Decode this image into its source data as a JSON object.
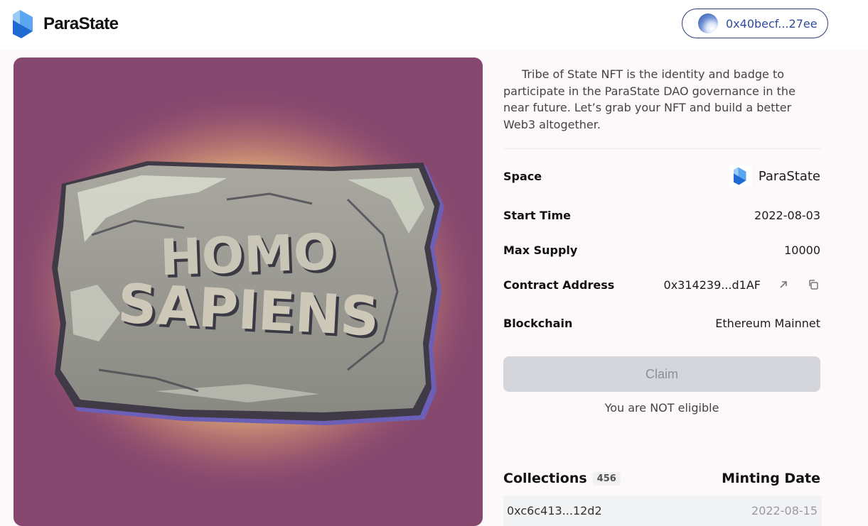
{
  "header": {
    "brand": "ParaState",
    "wallet_address": "0x40becf...27ee"
  },
  "nft": {
    "artwork_text_line1": "HOMO",
    "artwork_text_line2": "SAPIENS"
  },
  "description": "Tribe of State NFT is the identity and badge to participate in the ParaState DAO governance in the near future. Let’s grab your NFT and build a better Web3 altogether.",
  "details": {
    "space_label": "Space",
    "space_value": "ParaState",
    "start_time_label": "Start Time",
    "start_time_value": "2022-08-03",
    "max_supply_label": "Max Supply",
    "max_supply_value": "10000",
    "contract_label": "Contract Address",
    "contract_value": "0x314239...d1AF",
    "blockchain_label": "Blockchain",
    "blockchain_value": "Ethereum Mainnet"
  },
  "claim": {
    "button_label": "Claim",
    "eligibility_text": "You are NOT eligible"
  },
  "collections": {
    "title": "Collections",
    "count": "456",
    "minting_date_title": "Minting Date",
    "rows": [
      {
        "address": "0xc6c413...12d2",
        "date": "2022-08-15"
      }
    ]
  },
  "icons": {
    "brand_logo": "parastate-logo-icon",
    "external_link": "arrow-up-right-icon",
    "copy": "copy-icon",
    "wallet_avatar": "avatar-icon"
  },
  "colors": {
    "accent": "#2d4c9b",
    "nft_background": "#87486f",
    "claim_disabled_bg": "#d5d6dc",
    "claim_disabled_text": "#8c8f98",
    "logo_blue": "#2f7bd8"
  }
}
